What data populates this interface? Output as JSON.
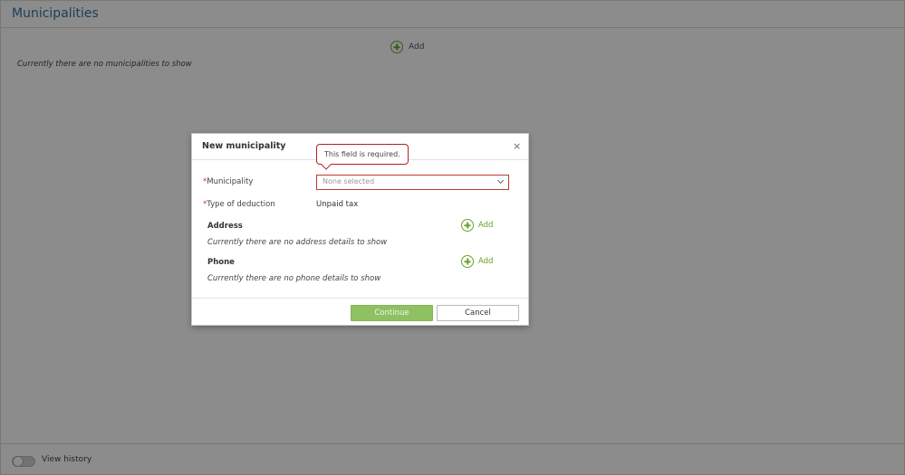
{
  "page": {
    "title": "Municipalities",
    "add_label": "Add",
    "empty_text": "Currently there are no municipalities to show",
    "footer": {
      "history_label": "View history"
    }
  },
  "modal": {
    "title": "New municipality",
    "close_symbol": "×",
    "tooltip": "This field is required.",
    "required_marker": "*",
    "fields": {
      "municipality": {
        "label": "Municipality",
        "placeholder": "None selected"
      },
      "deduction": {
        "label": "Type of deduction",
        "value": "Unpaid tax"
      }
    },
    "address": {
      "title": "Address",
      "add_label": "Add",
      "empty_text": "Currently there are no address details to show"
    },
    "phone": {
      "title": "Phone",
      "add_label": "Add",
      "empty_text": "Currently there are no phone details to show"
    },
    "buttons": {
      "continue": "Continue",
      "cancel": "Cancel"
    }
  },
  "colors": {
    "accent_green": "#6aa22c",
    "continue_button": "#8fc162",
    "error_red": "#c0392b",
    "title_blue": "#3a6f9a"
  }
}
